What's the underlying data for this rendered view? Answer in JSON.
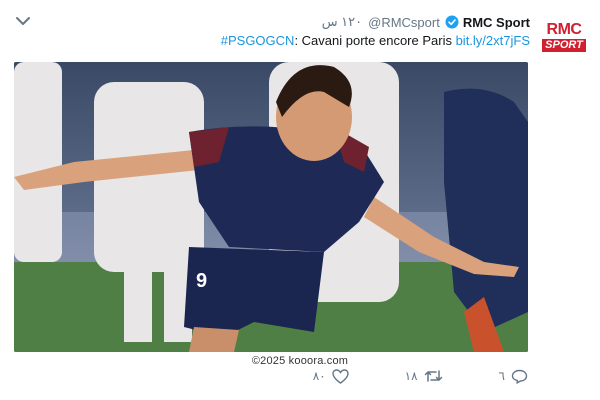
{
  "tweet": {
    "account_name": "RMC Sport",
    "handle": "@RMCsport",
    "time": "١٢٠ س",
    "hashtag": "#PSGOGCN",
    "text_body": ": Cavani porte encore Paris ",
    "link": "bit.ly/2xt7jFS",
    "logo_top": "RMC",
    "logo_bottom": "SPORT",
    "watermark": "©2025 kooora.com",
    "jersey_number": "9",
    "counts": {
      "likes": "٨٠",
      "retweets": "١٨",
      "replies": "٦"
    },
    "icons": {
      "menu": "chevron-down-icon",
      "verified": "verified-badge-icon",
      "like": "heart-icon",
      "retweet": "retweet-icon",
      "reply": "reply-icon"
    },
    "colors": {
      "link": "#1b95e0",
      "brand": "#d1202f",
      "verified": "#1da1f2",
      "muted": "#657786"
    }
  }
}
